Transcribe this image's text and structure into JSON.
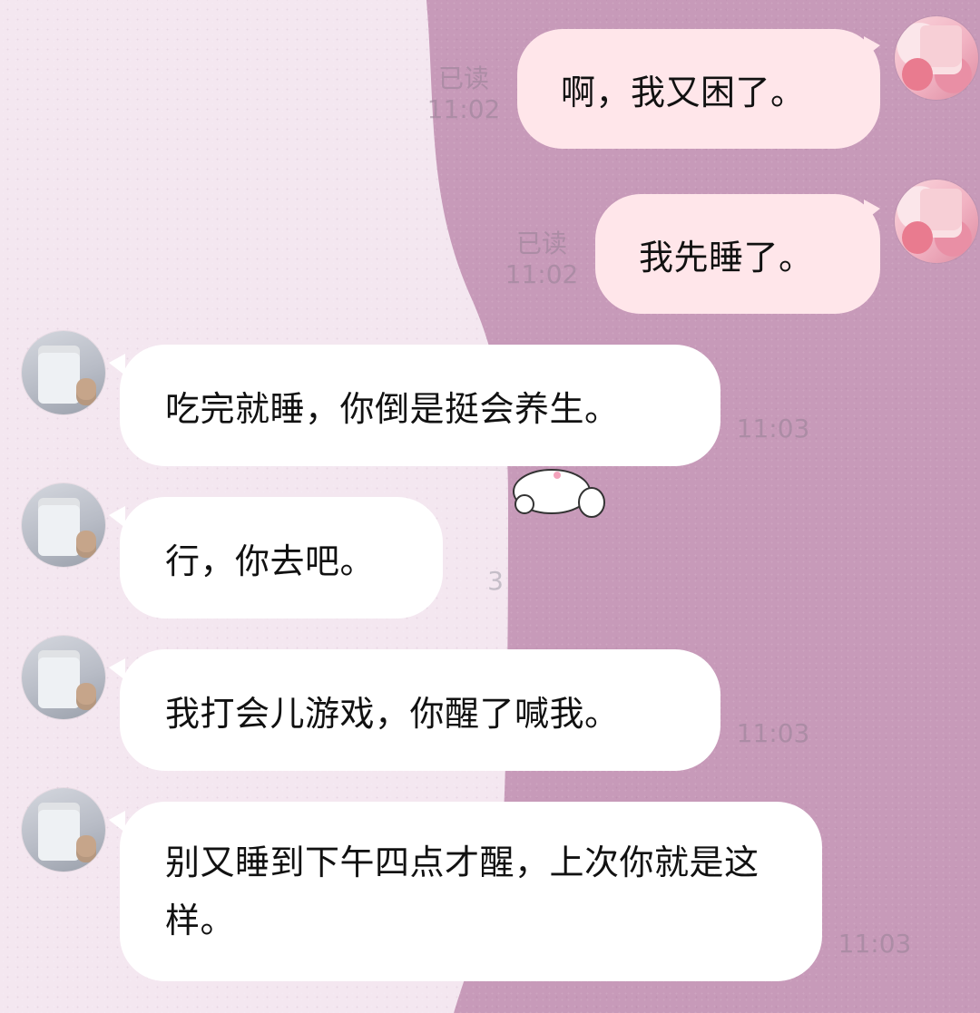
{
  "chat": {
    "messages": [
      {
        "side": "right",
        "text": "啊，我又困了。",
        "status": "已读",
        "time": "11:02"
      },
      {
        "side": "right",
        "text": "我先睡了。",
        "status": "已读",
        "time": "11:02"
      },
      {
        "side": "left",
        "text": "吃完就睡，你倒是挺会养生。",
        "time": "11:03"
      },
      {
        "side": "left",
        "text": "行，你去吧。",
        "time": "3"
      },
      {
        "side": "left",
        "text": "我打会儿游戏，你醒了喊我。",
        "time": "11:03"
      },
      {
        "side": "left",
        "text": "别又睡到下午四点才醒，上次你就是这样。",
        "time": "11:03"
      }
    ]
  },
  "colors": {
    "right_bubble": "#ffe6ea",
    "left_bubble": "#ffffff",
    "left_background": "#f4e7f0",
    "right_background": "#c79ab9"
  }
}
